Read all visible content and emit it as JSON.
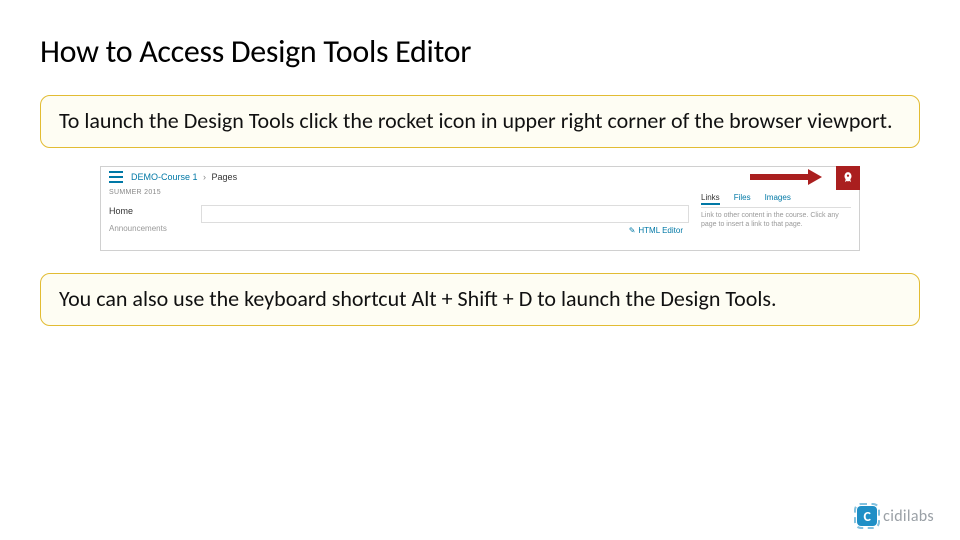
{
  "title": "How to Access Design Tools Editor",
  "callouts": {
    "first": "To launch the Design Tools click the rocket icon in upper right corner of the browser viewport.",
    "second": "You can also use the keyboard shortcut Alt + Shift + D to launch the Design Tools."
  },
  "screenshot": {
    "breadcrumb": {
      "course": "DEMO-Course 1",
      "sep": "›",
      "page": "Pages"
    },
    "leftnav": {
      "term": "SUMMER 2015",
      "home": "Home",
      "announcements": "Announcements"
    },
    "editor_link": "HTML Editor",
    "tabs": {
      "links": "Links",
      "files": "Files",
      "images": "Images"
    },
    "hint": "Link to other content in the course. Click any page to insert a link to that page."
  },
  "logo": {
    "badge": "C",
    "text": "cidilabs"
  }
}
